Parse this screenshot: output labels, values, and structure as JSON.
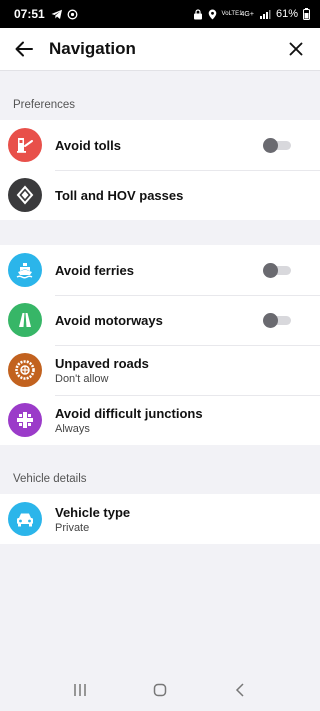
{
  "status_bar": {
    "time": "07:51",
    "battery": "61%",
    "network": "4G+",
    "volte": "VoLTE1"
  },
  "app_bar": {
    "title": "Navigation"
  },
  "preferences": {
    "label": "Preferences",
    "items": [
      {
        "title": "Avoid tolls",
        "icon": "toll-icon",
        "color": "#e8504a",
        "toggle": false
      },
      {
        "title": "Toll and HOV passes",
        "icon": "diamond-icon",
        "color": "#3a3a3c"
      }
    ]
  },
  "routing": {
    "items": [
      {
        "title": "Avoid ferries",
        "icon": "ferry-icon",
        "color": "#2bb5ea",
        "toggle": false
      },
      {
        "title": "Avoid motorways",
        "icon": "motorway-icon",
        "color": "#37b667",
        "toggle": false
      },
      {
        "title": "Unpaved roads",
        "subtitle": "Don't allow",
        "icon": "wheel-icon",
        "color": "#c2621f"
      },
      {
        "title": "Avoid difficult junctions",
        "subtitle": "Always",
        "icon": "junction-icon",
        "color": "#9b3bc9"
      }
    ]
  },
  "vehicle": {
    "label": "Vehicle details",
    "items": [
      {
        "title": "Vehicle type",
        "subtitle": "Private",
        "icon": "car-icon",
        "color": "#2bb5ea"
      }
    ]
  },
  "colors": {
    "background": "#f2f2f6",
    "toggle_off_knob": "#6a6a70",
    "toggle_off_track": "#d8d8dc"
  }
}
